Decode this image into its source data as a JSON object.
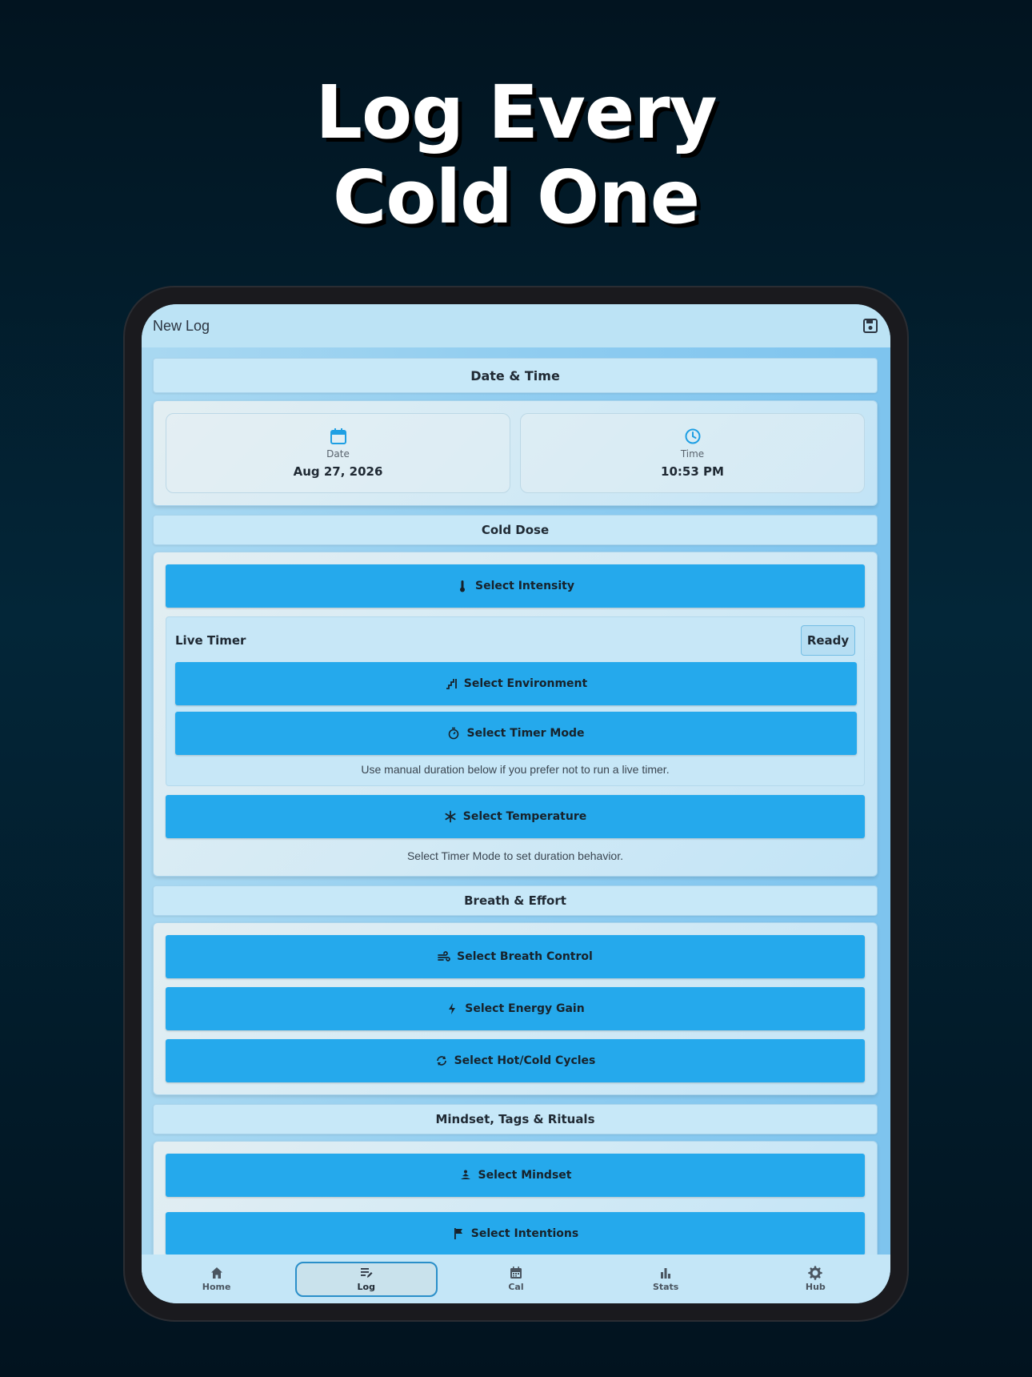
{
  "headline": {
    "line1": "Log Every",
    "line2": "Cold One"
  },
  "appbar": {
    "title": "New Log",
    "save_icon": "save-icon"
  },
  "sections": {
    "date_time": {
      "header": "Date & Time",
      "date": {
        "label": "Date",
        "value": "Aug 27, 2026",
        "icon": "calendar-icon"
      },
      "time": {
        "label": "Time",
        "value": "10:53 PM",
        "icon": "clock-icon"
      }
    },
    "cold_dose": {
      "header": "Cold Dose",
      "intensity_label": "Select Intensity",
      "live_timer": {
        "title": "Live Timer",
        "status": "Ready",
        "environment_label": "Select Environment",
        "timer_mode_label": "Select Timer Mode",
        "hint": "Use manual duration below if you prefer not to run a live timer."
      },
      "temperature_label": "Select Temperature",
      "hint": "Select Timer Mode to set duration behavior."
    },
    "breath_effort": {
      "header": "Breath & Effort",
      "breath_label": "Select Breath Control",
      "energy_label": "Select Energy Gain",
      "cycles_label": "Select Hot/Cold Cycles"
    },
    "mindset": {
      "header": "Mindset, Tags & Rituals",
      "mindset_label": "Select Mindset",
      "intentions_label": "Select Intentions"
    }
  },
  "bottom_nav": {
    "items": [
      {
        "label": "Home",
        "icon": "home-icon"
      },
      {
        "label": "Log",
        "icon": "log-icon",
        "active": true
      },
      {
        "label": "Cal",
        "icon": "calendar-icon"
      },
      {
        "label": "Stats",
        "icon": "stats-icon"
      },
      {
        "label": "Hub",
        "icon": "gear-icon"
      }
    ]
  },
  "colors": {
    "background": "#03202f",
    "accent": "#25a9ec",
    "icon_blue": "#1e9fe3",
    "appbar": "#bce3f5"
  }
}
